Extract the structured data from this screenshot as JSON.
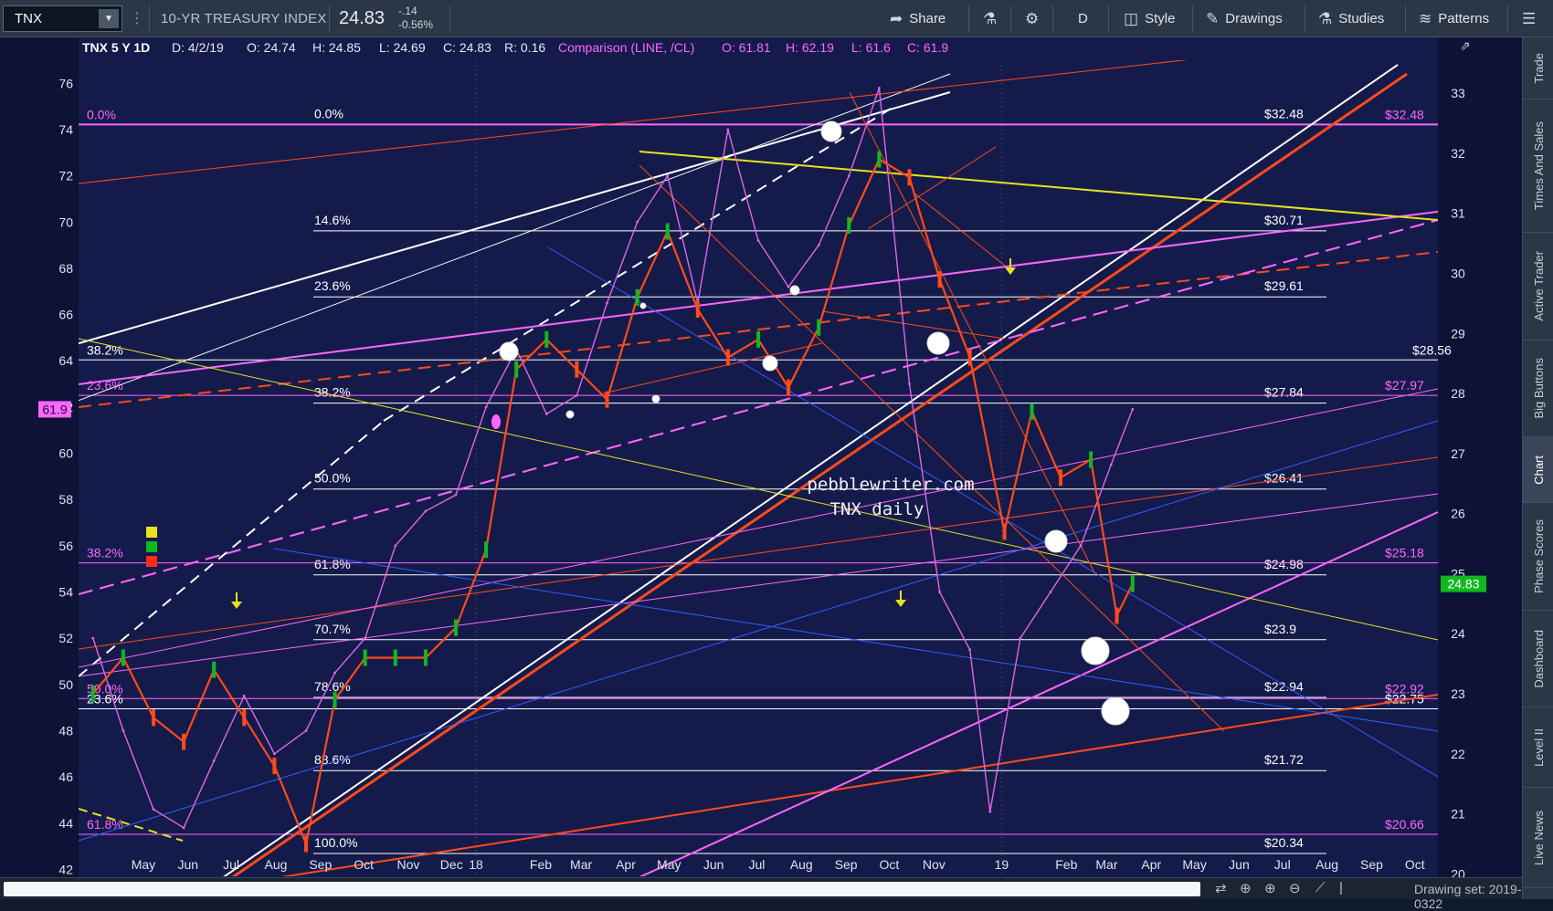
{
  "toolbar": {
    "symbol": "TNX",
    "instrument": "10-YR TREASURY INDEX",
    "last": "24.83",
    "change": "-.14",
    "change_pct": "-0.56%",
    "share": "Share",
    "period": "D",
    "style": "Style",
    "drawings": "Drawings",
    "studies": "Studies",
    "patterns": "Patterns"
  },
  "header": {
    "title": "TNX 5 Y 1D",
    "date": "D: 4/2/19",
    "open": "O: 24.74",
    "high": "H: 24.85",
    "low": "L: 24.69",
    "close": "C: 24.83",
    "range": "R: 0.16",
    "comparison": "Comparison (LINE, /CL)",
    "c_open": "O: 61.81",
    "c_high": "H: 62.19",
    "c_low": "L: 61.6",
    "c_close": "C: 61.9"
  },
  "side_tabs": [
    "Trade",
    "Times And Sales",
    "Active Trader",
    "Big Buttons",
    "Chart",
    "Phase Scores",
    "Dashboard",
    "Level II",
    "Live News"
  ],
  "status": {
    "drawing_set": "Drawing set: 2019-0322"
  },
  "colors": {
    "background": "#141b4a",
    "comparison": "#e066e6",
    "fib": "#ff66ff",
    "trend": "#ff4a1a",
    "yellow": "#e8e020",
    "price_tag": "#10b820",
    "cl_tag": "#ff66ff"
  },
  "chart_data": {
    "type": "line",
    "title": "TNX 5 Y 1D",
    "watermark": [
      "pebblewriter.com",
      "TNX daily"
    ],
    "x_ticks": [
      "May",
      "Jun",
      "Jul",
      "Aug",
      "Sep",
      "Oct",
      "Nov",
      "Dec",
      "18",
      "Feb",
      "Mar",
      "Apr",
      "May",
      "Jun",
      "Jul",
      "Aug",
      "Sep",
      "Oct",
      "Nov",
      "19",
      "Feb",
      "Mar",
      "Apr",
      "May",
      "Jun",
      "Jul",
      "Aug",
      "Sep",
      "Oct"
    ],
    "left_axis": {
      "label": "Comparison (LINE, /CL)",
      "ticks": [
        42,
        44,
        46,
        48,
        50,
        52,
        54,
        56,
        58,
        60,
        62,
        64,
        66,
        68,
        70,
        72,
        74,
        76
      ],
      "ylim": [
        41.7,
        77.0
      ],
      "last_tag": "61.9"
    },
    "right_axis": {
      "label": "TNX",
      "ticks": [
        20,
        21,
        22,
        23,
        24,
        25,
        26,
        27,
        28,
        29,
        30,
        31,
        32,
        33
      ],
      "ylim": [
        19.96,
        33.55
      ],
      "last_tag": "24.83"
    },
    "fib_levels_tnx": [
      {
        "pct": "0.0%",
        "value": "$32.48",
        "v": 32.48
      },
      {
        "pct": "14.6%",
        "value": "$30.71",
        "v": 30.71
      },
      {
        "pct": "23.6%",
        "value": "$29.61",
        "v": 29.61
      },
      {
        "pct": "38.2%",
        "value": "$27.84",
        "v": 27.84
      },
      {
        "pct": "50.0%",
        "value": "$26.41",
        "v": 26.41
      },
      {
        "pct": "61.8%",
        "value": "$24.98",
        "v": 24.98
      },
      {
        "pct": "70.7%",
        "value": "$23.9",
        "v": 23.9
      },
      {
        "pct": "78.6%",
        "value": "$22.94",
        "v": 22.94
      },
      {
        "pct": "88.6%",
        "value": "$21.72",
        "v": 21.72
      },
      {
        "pct": "100.0%",
        "value": "$20.34",
        "v": 20.34
      }
    ],
    "fib_levels_cl": [
      {
        "pct": "0.0%",
        "value": "$32.48",
        "v": 32.48
      },
      {
        "pct": "23.6%",
        "value": "$27.97",
        "v": 27.97
      },
      {
        "pct": "38.2%",
        "value": "$25.18",
        "v": 25.18
      },
      {
        "pct": "50.0%",
        "value": "$22.92",
        "v": 22.92
      },
      {
        "pct": "61.8%",
        "value": "$20.66",
        "v": 20.66
      }
    ],
    "extra_levels": [
      {
        "pct": "38.2%",
        "value": "$28.56",
        "v": 28.56
      },
      {
        "pct": "23.6%",
        "value": "$22.75",
        "v": 22.75
      }
    ],
    "series": [
      {
        "name": "TNX",
        "x": [
          "2017-04-10",
          "2017-05-01",
          "2017-05-22",
          "2017-06-12",
          "2017-07-03",
          "2017-07-24",
          "2017-08-14",
          "2017-09-05",
          "2017-09-25",
          "2017-10-16",
          "2017-11-06",
          "2017-11-27",
          "2017-12-18",
          "2018-01-08",
          "2018-01-29",
          "2018-02-19",
          "2018-03-12",
          "2018-04-02",
          "2018-04-23",
          "2018-05-14",
          "2018-06-04",
          "2018-06-25",
          "2018-07-16",
          "2018-08-06",
          "2018-08-27",
          "2018-09-17",
          "2018-10-08",
          "2018-10-29",
          "2018-11-19",
          "2018-12-10",
          "2019-01-03",
          "2019-01-22",
          "2019-02-11",
          "2019-03-04",
          "2019-03-22",
          "2019-04-02"
        ],
        "y": [
          23.0,
          23.6,
          22.6,
          22.2,
          23.4,
          22.6,
          21.8,
          20.5,
          22.9,
          23.6,
          23.6,
          23.6,
          24.1,
          25.4,
          28.4,
          28.9,
          28.4,
          27.9,
          29.6,
          30.7,
          29.4,
          28.6,
          28.9,
          28.1,
          29.1,
          30.8,
          31.9,
          31.6,
          29.9,
          28.6,
          25.7,
          27.7,
          26.6,
          26.9,
          24.3,
          24.83
        ]
      },
      {
        "name": "Comparison (LINE, /CL)",
        "x": [
          "2017-04-10",
          "2017-05-01",
          "2017-05-22",
          "2017-06-12",
          "2017-07-03",
          "2017-07-24",
          "2017-08-14",
          "2017-09-05",
          "2017-09-25",
          "2017-10-16",
          "2017-11-06",
          "2017-11-27",
          "2017-12-18",
          "2018-01-08",
          "2018-01-29",
          "2018-02-19",
          "2018-03-12",
          "2018-04-02",
          "2018-04-23",
          "2018-05-14",
          "2018-06-04",
          "2018-06-25",
          "2018-07-16",
          "2018-08-06",
          "2018-08-27",
          "2018-09-17",
          "2018-10-08",
          "2018-10-29",
          "2018-11-19",
          "2018-12-10",
          "2018-12-24",
          "2019-01-14",
          "2019-02-04",
          "2019-02-25",
          "2019-03-18",
          "2019-04-02"
        ],
        "y": [
          52.0,
          48.0,
          44.6,
          43.8,
          46.7,
          49.5,
          47.0,
          48.0,
          50.5,
          52.0,
          56.0,
          57.5,
          58.2,
          62.0,
          64.5,
          61.7,
          62.5,
          66.5,
          70.0,
          72.0,
          66.5,
          74.0,
          69.2,
          67.2,
          69.0,
          72.0,
          75.8,
          63.0,
          54.0,
          51.5,
          44.5,
          52.0,
          54.0,
          56.0,
          59.5,
          61.9
        ]
      }
    ]
  }
}
